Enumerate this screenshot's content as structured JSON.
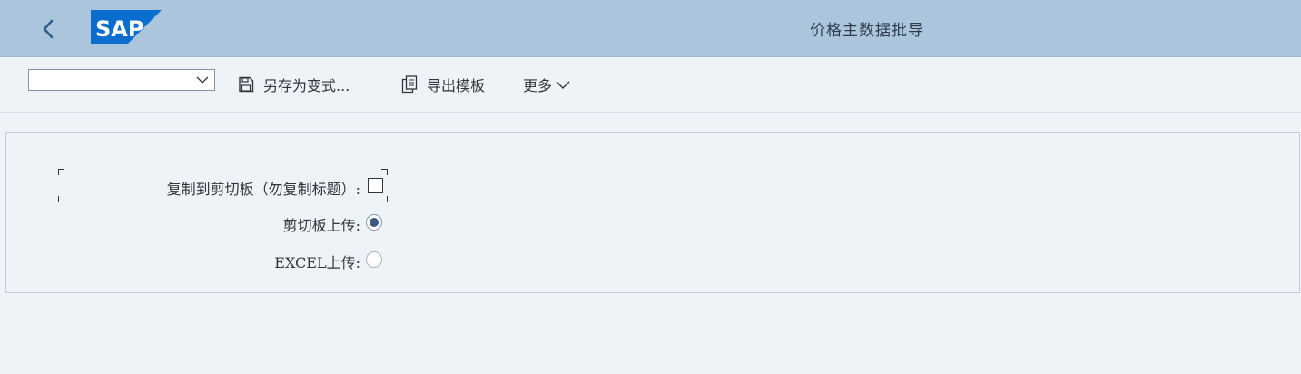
{
  "shell": {
    "title": "价格主数据批导",
    "logo_text": "SAP",
    "back_icon": "chevron-left-icon",
    "brand_color": "#0a6ed1",
    "bar_color": "#abc5dc"
  },
  "toolbar": {
    "variant_value": "",
    "save_as_variant_label": "另存为变式...",
    "save_icon": "floppy-disk-icon",
    "export_template_label": "导出模板",
    "export_icon": "copy-document-icon",
    "more_label": "更多"
  },
  "form": {
    "copy_to_clipboard_label": "复制到剪切板（勿复制标题）:",
    "copy_to_clipboard_checked": false,
    "clipboard_upload_label": "剪切板上传:",
    "clipboard_upload_selected": true,
    "excel_upload_label": "EXCEL上传:",
    "excel_upload_selected": false
  }
}
